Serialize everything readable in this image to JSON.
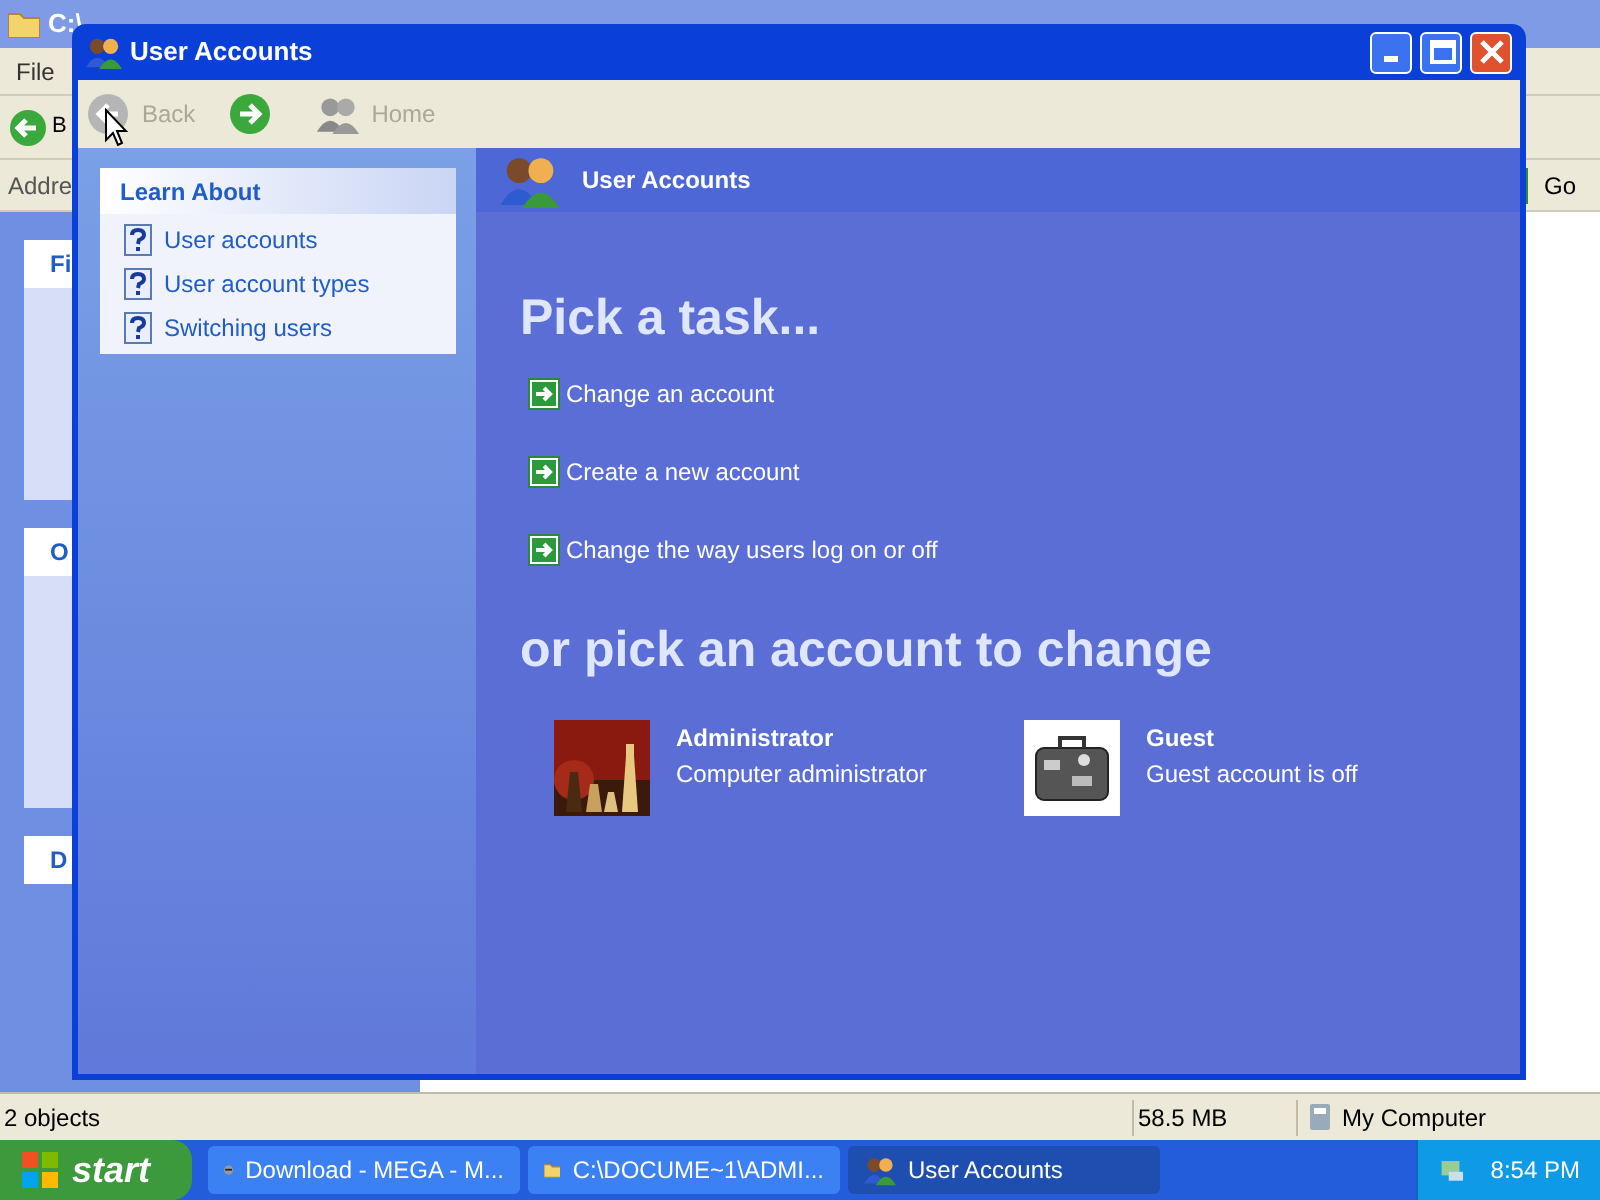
{
  "background_window": {
    "title": "C:\\",
    "menu": [
      "File"
    ],
    "back_label": "B",
    "address_label": "Addre",
    "go": "Go",
    "panels": [
      "Fi",
      "O",
      "D"
    ],
    "status_bar": [
      "2 objects",
      "58.5 MB",
      "My Computer"
    ]
  },
  "window": {
    "title": "User Accounts"
  },
  "toolbar": [
    {
      "kind": "back",
      "label": "Back",
      "disabled": true
    },
    {
      "kind": "forward",
      "disabled": false
    },
    {
      "kind": "home",
      "label": "Home",
      "disabled": true
    }
  ],
  "learn_about": {
    "title": "Learn About",
    "items": [
      "User accounts",
      "User account types",
      "Switching users"
    ]
  },
  "header": {
    "title": "User Accounts"
  },
  "tasks": {
    "title": "Pick a task...",
    "items": [
      "Change an account",
      "Create a new account",
      "Change the way users log on or off"
    ]
  },
  "accounts": {
    "title": "or pick an account to change",
    "items": [
      {
        "name": "Administrator",
        "description": "Computer administrator"
      },
      {
        "name": "Guest",
        "description": "Guest account is off",
        "kind": "suitcase"
      }
    ]
  },
  "taskbar": {
    "start": "start",
    "buttons": [
      {
        "label": "Download - MEGA - M...",
        "selected": false
      },
      {
        "label": "C:\\DOCUME~1\\ADMI...",
        "selected": false
      },
      {
        "label": "User Accounts",
        "selected": true
      }
    ],
    "clock": "8:54 PM"
  }
}
